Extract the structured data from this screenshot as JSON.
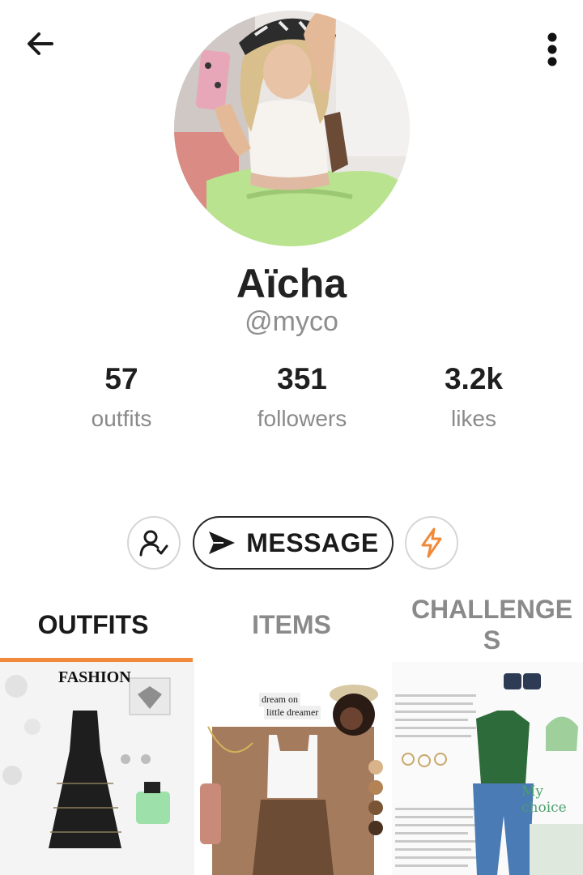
{
  "header": {
    "back_icon": "arrow-left-icon",
    "more_icon": "more-vertical-icon"
  },
  "profile": {
    "name": "Aïcha",
    "handle": "@myco",
    "stats": [
      {
        "value": "57",
        "label": "outfits"
      },
      {
        "value": "351",
        "label": "followers"
      },
      {
        "value": "3.2k",
        "label": "likes"
      }
    ]
  },
  "actions": {
    "follow_icon": "user-check-icon",
    "message_label": "MESSAGE",
    "message_icon": "send-icon",
    "boost_icon": "lightning-icon",
    "accent_color": "#f08a3a"
  },
  "tabs": [
    {
      "label": "OUTFITS",
      "active": true
    },
    {
      "label": "ITEMS",
      "active": false
    },
    {
      "label": "CHALLENGE\nS",
      "active": false
    }
  ],
  "outfits": [
    {
      "text_1": "FASHION"
    },
    {
      "text_1": "dream on",
      "text_2": "little dreamer"
    },
    {
      "text_1": "My choice"
    }
  ]
}
